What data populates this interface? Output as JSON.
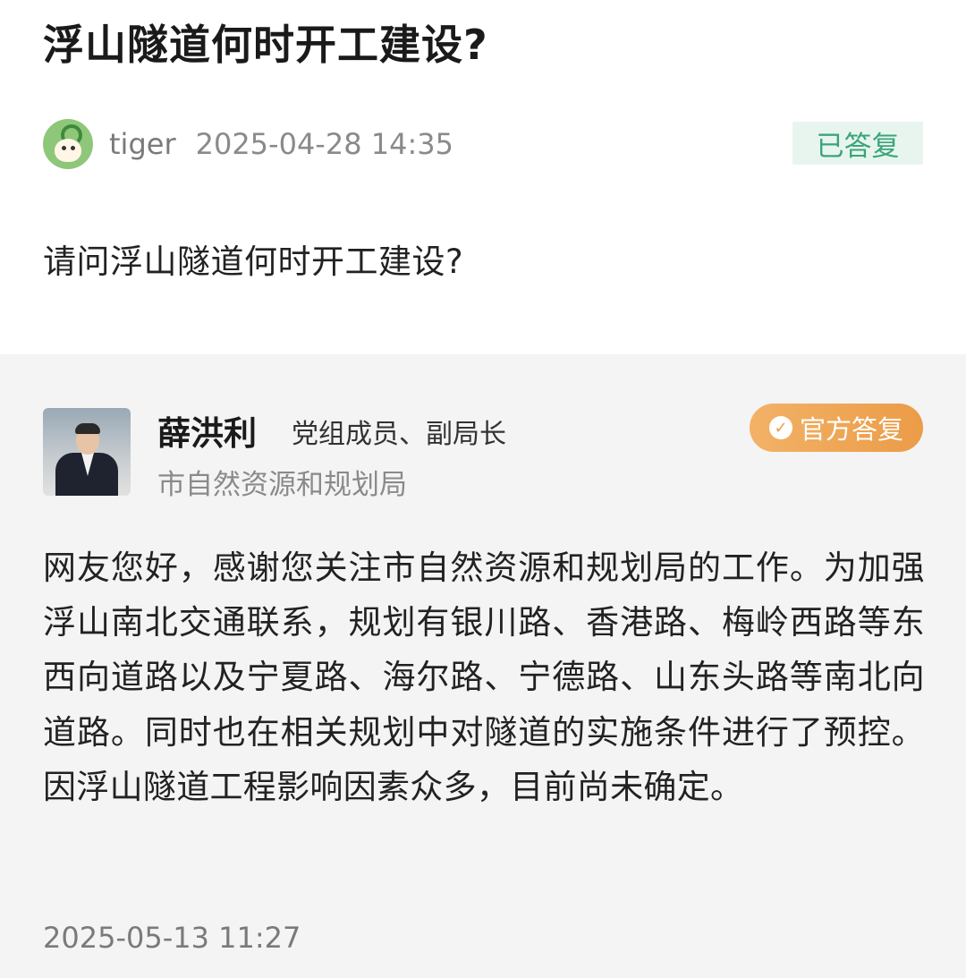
{
  "question": {
    "title": "浮山隧道何时开工建设?",
    "author": "tiger",
    "time": "2025-04-28 14:35",
    "status": "已答复",
    "body": "请问浮山隧道何时开工建设?"
  },
  "answer": {
    "name": "薛洪利",
    "role": "党组成员、副局长",
    "org": "市自然资源和规划局",
    "badge": "官方答复",
    "body": "网友您好，感谢您关注市自然资源和规划局的工作。为加强浮山南北交通联系，规划有银川路、香港路、梅岭西路等东西向道路以及宁夏路、海尔路、宁德路、山东头路等南北向道路。同时也在相关规划中对隧道的实施条件进行了预控。因浮山隧道工程影响因素众多，目前尚未确定。",
    "time": "2025-05-13 11:27"
  },
  "colors": {
    "status_bg": "#e8f5ef",
    "status_text": "#3aa57a",
    "badge": "#eb9c47",
    "answer_bg": "#f4f4f4"
  },
  "icons": {
    "avatar": "cartoon-avatar-icon",
    "badge": "check-badge-icon"
  }
}
